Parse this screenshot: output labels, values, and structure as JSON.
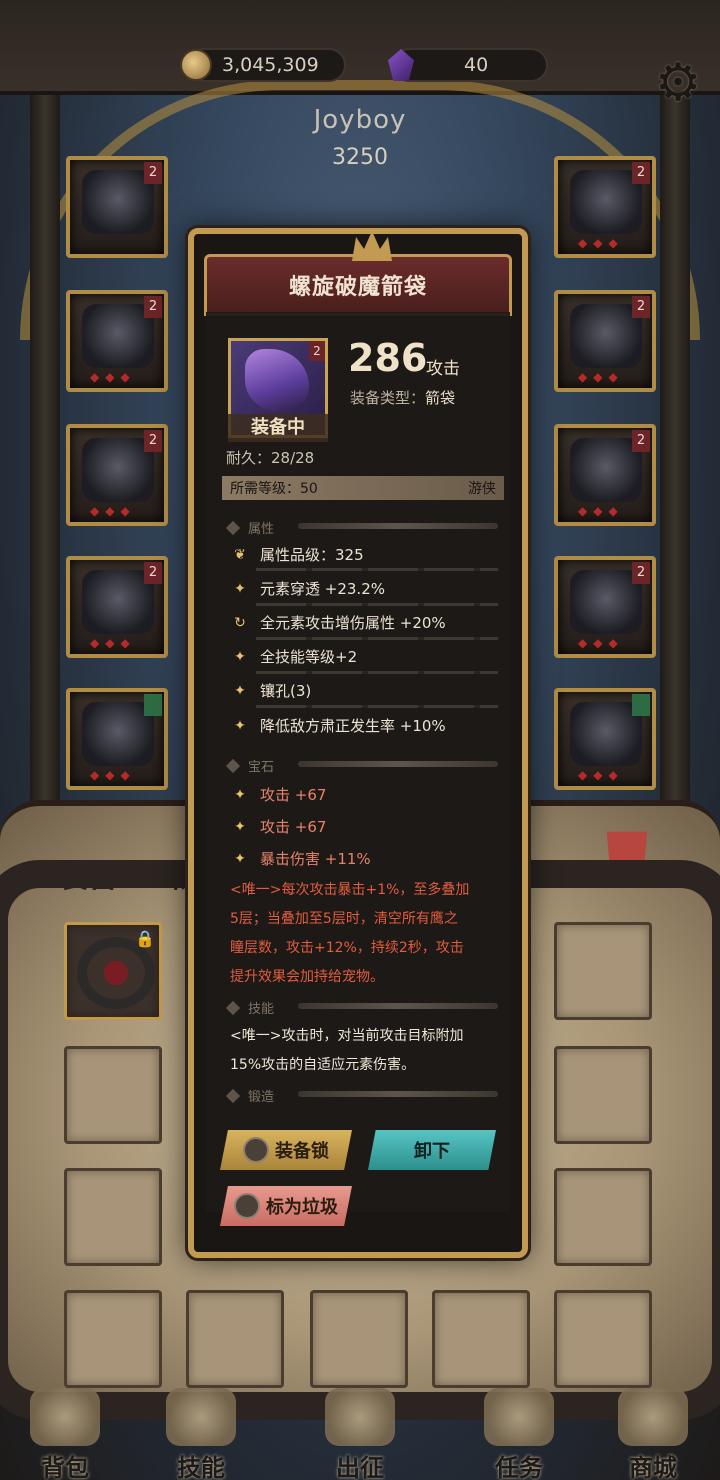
{
  "currency": {
    "coins": "3,045,309",
    "gems": "40"
  },
  "player": {
    "name": "Joyboy",
    "power": "3250"
  },
  "equip_slots": {
    "left": [
      {
        "level": "2",
        "gems": "◆◆◆"
      },
      {
        "level": "2",
        "gems": "◆◆◆"
      },
      {
        "level": "2",
        "gems": "◆◆◆"
      },
      {
        "level": "2",
        "gems": "◆◆◆"
      },
      {
        "level": "",
        "gems": "◆◆◆"
      }
    ],
    "right": [
      {
        "level": "2",
        "gems": "◆◆◆"
      },
      {
        "level": "2",
        "gems": "◆◆◆"
      },
      {
        "level": "2",
        "gems": "◆◆◆"
      },
      {
        "level": "2",
        "gems": "◆◆◆"
      },
      {
        "level": "",
        "gems": "◆◆◆"
      }
    ]
  },
  "tabs": {
    "equipment": "装备",
    "items": "物品"
  },
  "item": {
    "name": "螺旋破魔箭袋",
    "level_badge": "2",
    "equipped_label": "装备中",
    "attack_value": "286",
    "attack_unit": "攻击",
    "type_label": "装备类型：",
    "type_value": "箭袋",
    "durability": "耐久：28/28",
    "req_level": "所需等级：50",
    "req_class": "游侠",
    "section_attr": "属性",
    "section_gem": "宝石",
    "section_skill": "技能",
    "section_forge": "锻造",
    "attributes": [
      "属性品级：325",
      "元素穿透 +23.2%",
      "全元素攻击增伤属性 +20%",
      "全技能等级+2",
      "镶孔(3)",
      "降低敌方肃正发生率 +10%"
    ],
    "gems": [
      "攻击 +67",
      "攻击 +67",
      "暴击伤害 +11%"
    ],
    "unique_lines": [
      "<唯一>每次攻击暴击+1%，至多叠加",
      "5层；当叠加至5层时，清空所有鹰之",
      "瞳层数，攻击+12%，持续2秒，攻击",
      "提升效果会加持给宠物。"
    ],
    "skill_lines": [
      "<唯一>攻击时，对当前攻击目标附加",
      "15%攻击的自适应元素伤害。"
    ]
  },
  "buttons": {
    "lock": "装备锁",
    "unequip": "卸下",
    "mark_trash": "标为垃圾"
  },
  "nav": [
    {
      "label": "背包",
      "icon": "backpack-icon"
    },
    {
      "label": "技能",
      "icon": "skill-book-icon"
    },
    {
      "label": "出征",
      "icon": "sword-map-icon"
    },
    {
      "label": "任务",
      "icon": "scroll-icon"
    },
    {
      "label": "商城",
      "icon": "crown-shop-icon"
    }
  ],
  "colors": {
    "gold_border": "#c29a52",
    "unique_text": "#e25c3e",
    "gem_text": "#e6826b",
    "unequip_button": "#57c5c2"
  }
}
